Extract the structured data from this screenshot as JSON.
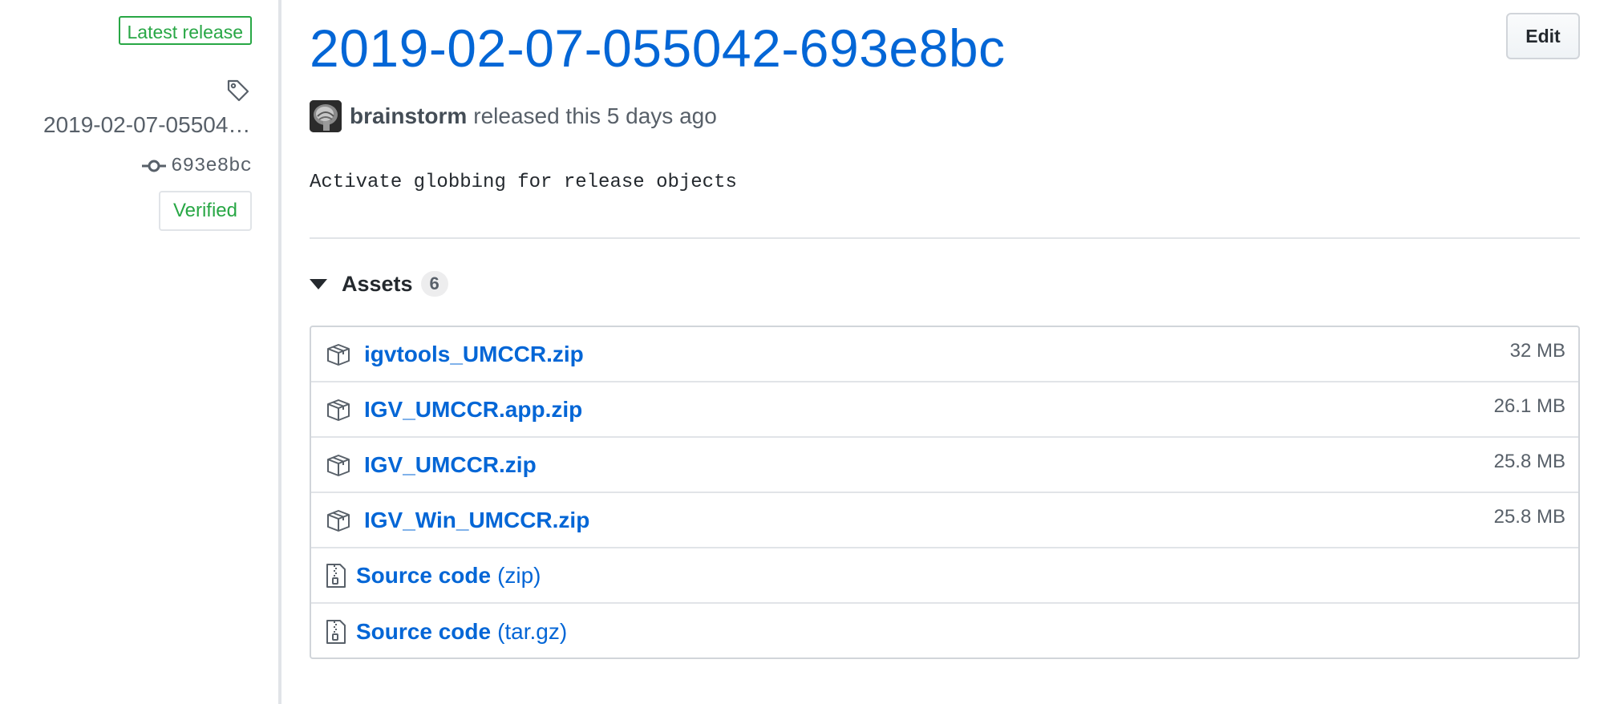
{
  "sidebar": {
    "latest_badge": "Latest release",
    "tag_name": "2019-02-07-055042-693e8bc",
    "commit_sha": "693e8bc",
    "verified_badge": "Verified"
  },
  "release": {
    "title": "2019-02-07-055042-693e8bc",
    "edit_label": "Edit",
    "author": "brainstorm",
    "released_text": "released this 5 days ago",
    "body": "Activate globbing for release objects"
  },
  "assets": {
    "label": "Assets",
    "count": "6",
    "items": [
      {
        "name": "igvtools_UMCCR.zip",
        "size": "32 MB",
        "icon": "package-icon"
      },
      {
        "name": "IGV_UMCCR.app.zip",
        "size": "26.1 MB",
        "icon": "package-icon"
      },
      {
        "name": "IGV_UMCCR.zip",
        "size": "25.8 MB",
        "icon": "package-icon"
      },
      {
        "name": "IGV_Win_UMCCR.zip",
        "size": "25.8 MB",
        "icon": "package-icon"
      },
      {
        "name": "Source code",
        "suffix": "(zip)",
        "icon": "file-zip-icon"
      },
      {
        "name": "Source code",
        "suffix": "(tar.gz)",
        "icon": "file-zip-icon"
      }
    ]
  },
  "colors": {
    "link": "#0366d6",
    "success": "#28a745",
    "muted": "#586069",
    "border": "#e1e4e8"
  }
}
